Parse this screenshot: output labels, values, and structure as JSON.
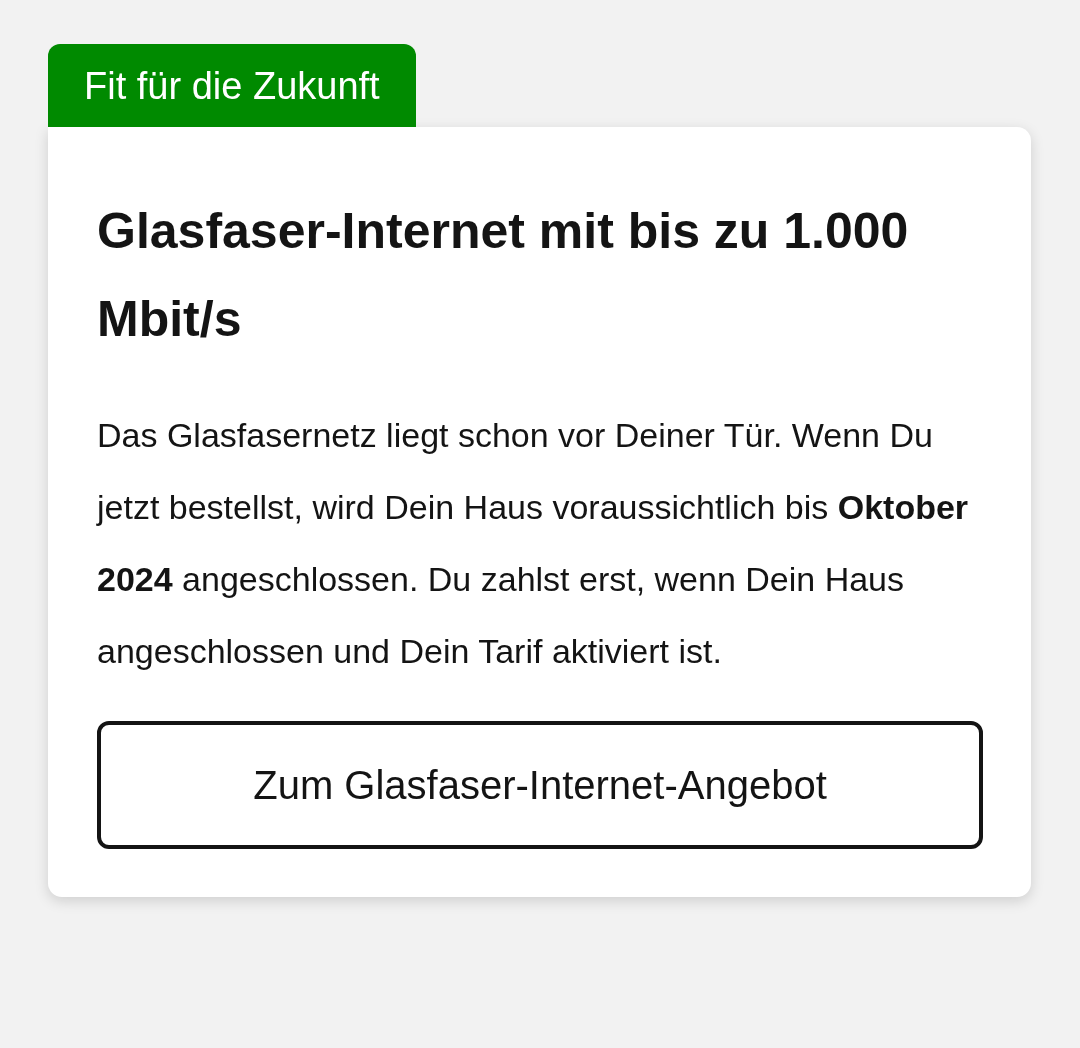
{
  "badge": "Fit für die Zukunft",
  "card": {
    "title": "Glasfaser-Internet mit bis zu 1.000 Mbit/s",
    "text": "Das Glasfasernetz liegt schon vor Deiner Tür. Wenn Du jetzt bestellst, wird Dein Haus voraussichtlich bis **Oktober 2024** angeschlossen. Du zahlst erst, wenn Dein Haus angeschlossen und Dein Tarif aktiviert ist.",
    "button": "Zum Glasfaser-Internet-Angebot"
  }
}
